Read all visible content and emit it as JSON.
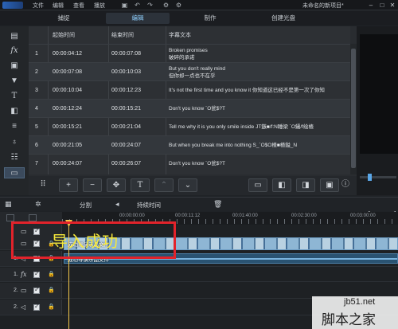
{
  "titlebar": {
    "menus": [
      "文件",
      "编辑",
      "查看",
      "播放"
    ],
    "project_title": "未命名的新项目*",
    "icons": [
      "save-icon",
      "undo-icon",
      "redo-icon",
      "settings-icon"
    ]
  },
  "tabs": [
    {
      "label": "捕捉",
      "active": false
    },
    {
      "label": "编辑",
      "active": true
    },
    {
      "label": "制作",
      "active": false
    },
    {
      "label": "创建光盘",
      "active": false
    }
  ],
  "tools": [
    "media-room-icon",
    "fx-icon",
    "pip-icon",
    "particle-icon",
    "title-icon",
    "transition-icon",
    "audio-mixing-icon",
    "voiceover-icon",
    "chapter-icon",
    "subtitle-icon"
  ],
  "subtitles": {
    "headers": [
      "起始时间",
      "结束时间",
      "字幕文本"
    ],
    "rows": [
      {
        "num": "1",
        "start": "00:00:04:12",
        "end": "00:00:07:08",
        "text": "Broken promises\n破碎的承诺"
      },
      {
        "num": "2",
        "start": "00:00:07:08",
        "end": "00:00:10:03",
        "text": "But you don't really mind\n但你却一点也不在乎"
      },
      {
        "num": "3",
        "start": "00:00:10:04",
        "end": "00:00:12:23",
        "text": "It's not the first time and you know it 你知道这已经不是第一次了你知"
      },
      {
        "num": "4",
        "start": "00:00:12:24",
        "end": "00:00:15:21",
        "text": "Don't you know `O瓮$?T"
      },
      {
        "num": "5",
        "start": "00:00:15:21",
        "end": "00:00:21:04",
        "text": "Tell me why it is you only smile inside JT鏃■/f:N睡梁 `O鑷/f绘楂"
      },
      {
        "num": "6",
        "start": "00:00:21:05",
        "end": "00:00:24:07",
        "text": "But when you break me into nothing S_`O$O楂■楂鎰_N"
      },
      {
        "num": "7",
        "start": "00:00:24:07",
        "end": "00:00:26:07",
        "text": "Don't you know `O瓮$?T"
      }
    ]
  },
  "subtitle_toolbar": [
    "add-icon",
    "remove-icon",
    "move-icon",
    "text-icon",
    "up-icon",
    "down-icon",
    "folder-icon",
    "import-icon",
    "export-icon",
    "settings-icon",
    "info-icon"
  ],
  "timeline_toolbar": {
    "split_label": "分割",
    "duration_label": "持续时间",
    "icons": [
      "magic-icon",
      "speaker-icon",
      "delete-icon"
    ]
  },
  "ruler": {
    "labels": [
      "00:00:00:00",
      "00:00:11:12",
      "00:01:40:00",
      "00:02:30:00",
      "00:03:00:00"
    ]
  },
  "tracks": {
    "video_clip_label": "成功导演示品文件",
    "audio_clip_label": "成功导演示品文件",
    "track_numbers": [
      "1.",
      "1.",
      "2.",
      "2."
    ]
  },
  "overlay": {
    "message": "导入成功"
  },
  "watermark": {
    "url": "jb51.net",
    "text": "脚本之家"
  }
}
